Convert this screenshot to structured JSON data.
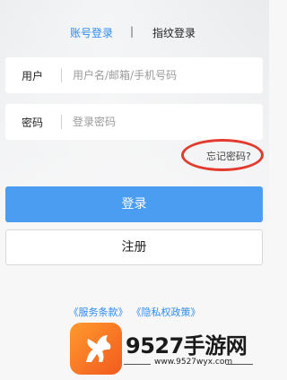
{
  "tabs": {
    "account_login": "账号登录",
    "separator": "|",
    "fingerprint_login": "指纹登录"
  },
  "form": {
    "user_label": "用户",
    "user_placeholder": "用户名/邮箱/手机号码",
    "password_label": "密码",
    "password_placeholder": "登录密码",
    "forgot_password": "忘记密码?"
  },
  "buttons": {
    "login": "登录",
    "register": "注册"
  },
  "footer": {
    "terms_of_service": "《服务条款》",
    "privacy_policy": "《隐私权政策》"
  },
  "watermark": {
    "brand": "9527手游网",
    "url": "www.9527wyx.com"
  },
  "colors": {
    "accent": "#2f8cf0",
    "login_button": "#4a9df0",
    "highlight_ring": "#e23a2c",
    "watermark_logo": "#f57a24"
  },
  "icons": {
    "watermark_logo": "horse-logo-icon"
  }
}
